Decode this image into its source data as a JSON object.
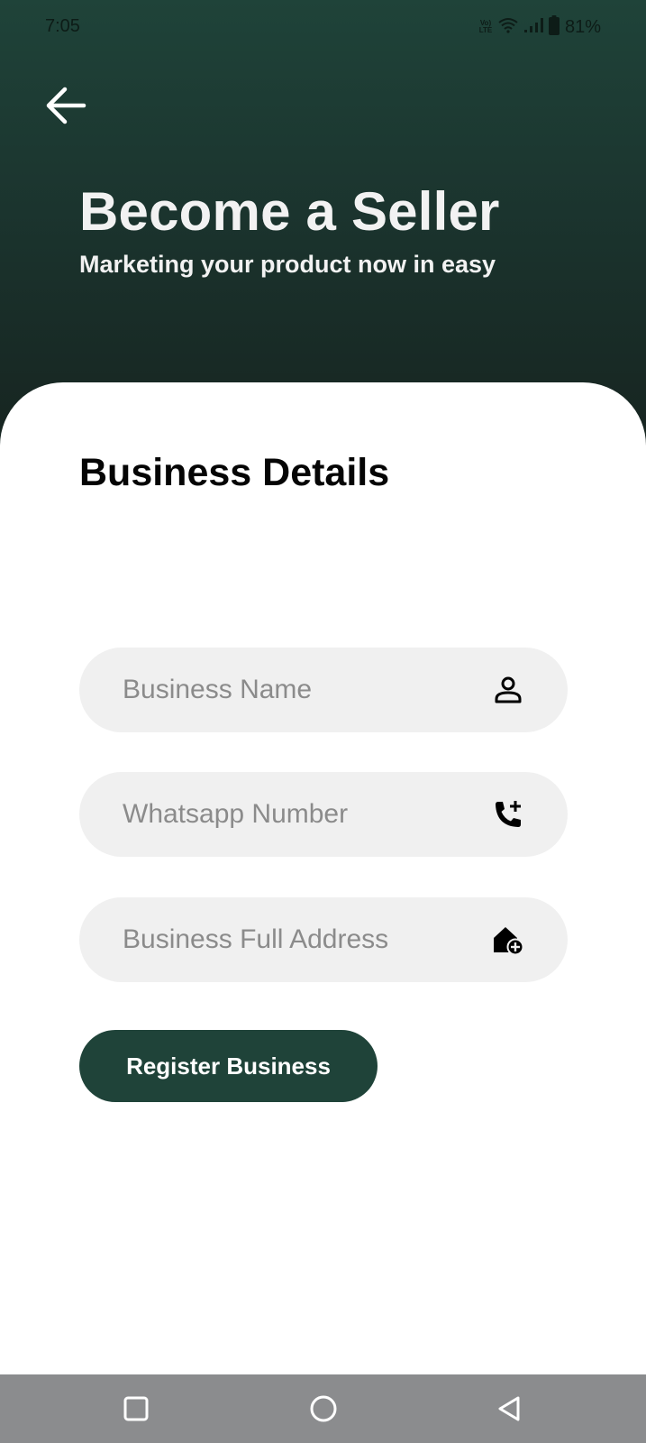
{
  "status_bar": {
    "time": "7:05",
    "volte_top": "Vo)",
    "volte_bottom": "LTE",
    "battery": "81%"
  },
  "header": {
    "back_icon": "arrow-left-icon",
    "title": "Become a Seller",
    "subtitle": "Marketing your product now in easy"
  },
  "form": {
    "section_title": "Business Details",
    "fields": [
      {
        "placeholder": "Business Name",
        "value": "",
        "icon": "person-icon"
      },
      {
        "placeholder": "Whatsapp Number",
        "value": "",
        "icon": "phone-add-icon"
      },
      {
        "placeholder": "Business Full Address",
        "value": "",
        "icon": "home-add-icon"
      }
    ],
    "submit_label": "Register Business"
  },
  "nav_bar": {
    "recents_icon": "square-icon",
    "home_icon": "circle-icon",
    "back_icon": "triangle-back-icon"
  },
  "colors": {
    "brand_dark_green": "#1f4339",
    "field_background": "#f0f0f0",
    "nav_bar": "#8b8c8e"
  }
}
